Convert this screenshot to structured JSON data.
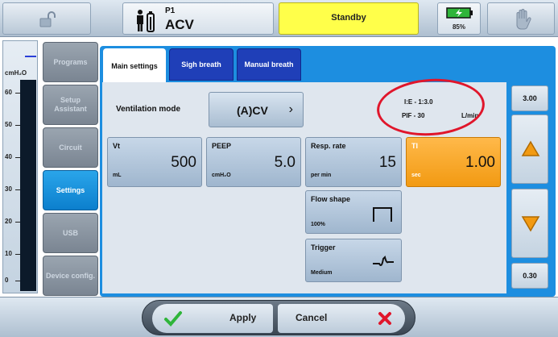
{
  "topbar": {
    "patient_id": "P1",
    "vent_mode": "ACV",
    "status": "Standby",
    "battery_pct": "85%"
  },
  "pressure_bar": {
    "unit": "cmH₂O",
    "ticks": [
      "60",
      "50",
      "40",
      "30",
      "20",
      "10",
      "0"
    ]
  },
  "nav": {
    "items": [
      {
        "label": "Programs"
      },
      {
        "label": "Setup Assistant"
      },
      {
        "label": "Circuit"
      },
      {
        "label": "Settings"
      },
      {
        "label": "USB"
      },
      {
        "label": "Device config."
      }
    ]
  },
  "tabs": [
    {
      "label": "Main settings"
    },
    {
      "label": "Sigh breath"
    },
    {
      "label": "Manual breath"
    }
  ],
  "main": {
    "mode_label": "Ventilation mode",
    "mode_value": "(A)CV",
    "ie_ratio": "I:E - 1:3.0",
    "pif": "PIF - 30",
    "pif_unit": "L/min",
    "params": [
      {
        "name": "Vt",
        "value": "500",
        "unit": "mL"
      },
      {
        "name": "PEEP",
        "value": "5.0",
        "unit": "cmH₂O"
      },
      {
        "name": "Resp. rate",
        "value": "15",
        "unit": "per min"
      },
      {
        "name": "TI",
        "value": "1.00",
        "unit": "sec"
      }
    ],
    "flow_shape": {
      "name": "Flow shape",
      "value": "100%"
    },
    "trigger": {
      "name": "Trigger",
      "value": "Medium"
    }
  },
  "right_panel": {
    "max": "3.00",
    "min": "0.30"
  },
  "bottom": {
    "apply": "Apply",
    "cancel": "Cancel"
  },
  "colors": {
    "accent": "#1d8ee0",
    "selected": "#f29a12",
    "status": "#ffff4a",
    "annotation": "#e0162b"
  }
}
